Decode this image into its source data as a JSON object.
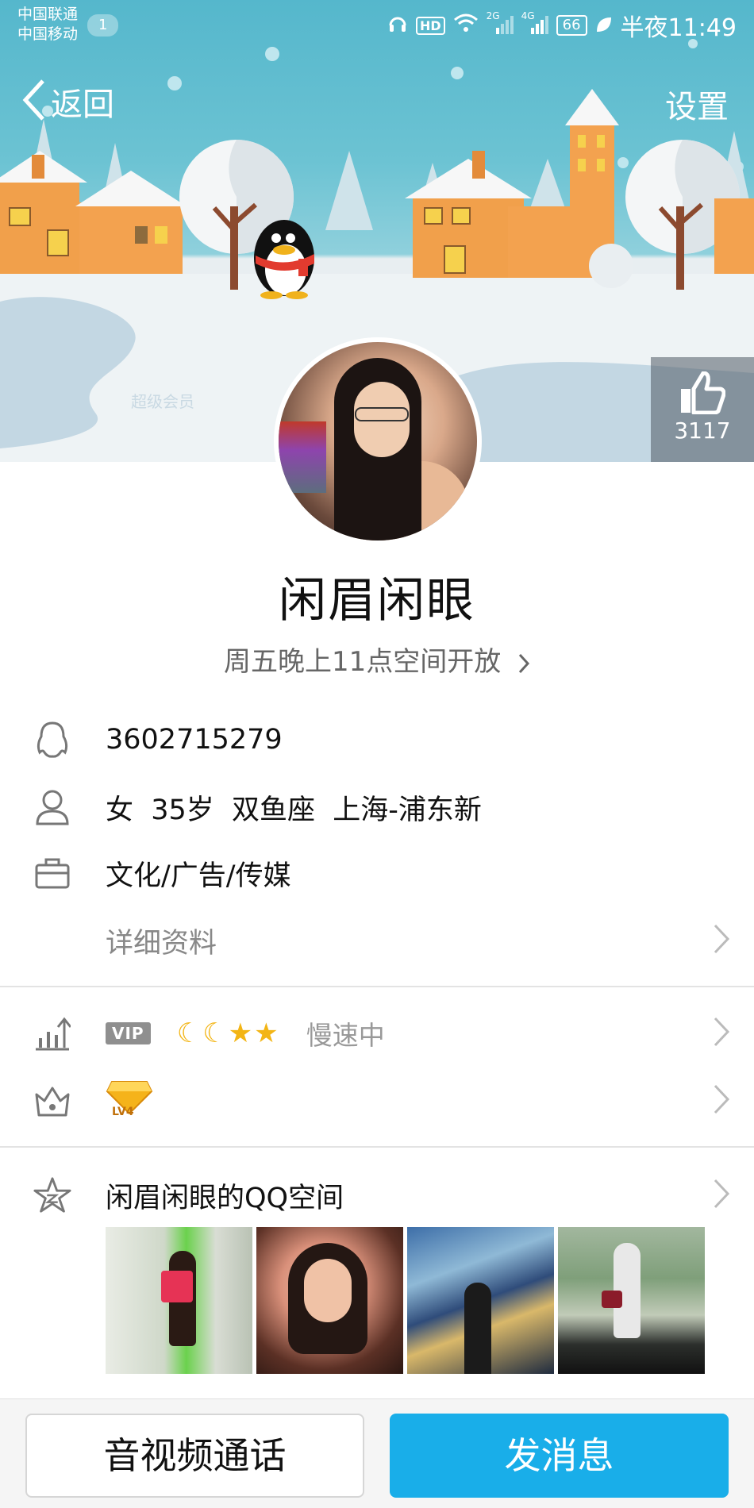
{
  "status_bar": {
    "carrier_1": "中国联通",
    "carrier_2": "中国移动",
    "notification_count": "1",
    "network_1": "2G",
    "network_2": "4G",
    "battery": "66",
    "time": "半夜11:49"
  },
  "header": {
    "back_label": "返回",
    "settings_label": "设置",
    "watermark": "超级会员",
    "likes": "3117"
  },
  "profile": {
    "name": "闲眉闲眼",
    "space_open": "周五晚上11点空间开放"
  },
  "info": {
    "qq_number": "3602715279",
    "basic": "女  35岁  双鱼座  上海-浦东新",
    "occupation": "文化/广告/传媒",
    "details_label": "详细资料"
  },
  "membership": {
    "vip_badge": "VIP",
    "level_icons": "☾☾★★",
    "speed_status": "慢速中",
    "diamond_level": "LV4"
  },
  "qzone": {
    "title": "闲眉闲眼的QQ空间"
  },
  "actions": {
    "call_label": "音视频通话",
    "message_label": "发消息"
  },
  "colors": {
    "accent": "#19aee9",
    "banner_sky": "#55b7cc"
  }
}
